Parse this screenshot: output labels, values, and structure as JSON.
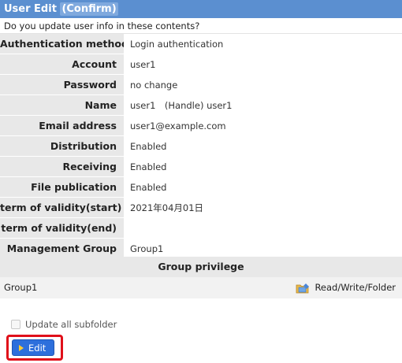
{
  "title": {
    "prefix": "User Edit ",
    "highlight": "(Confirm)"
  },
  "question": "Do you update user info in these contents?",
  "fields": [
    {
      "label": "Authentication method",
      "value": "Login authentication"
    },
    {
      "label": "Account",
      "value": "user1"
    },
    {
      "label": "Password",
      "value": "no change"
    },
    {
      "label": "Name",
      "value": "user1　(Handle) user1"
    },
    {
      "label": "Email address",
      "value": "user1@example.com"
    },
    {
      "label": "Distribution",
      "value": "Enabled"
    },
    {
      "label": "Receiving",
      "value": "Enabled"
    },
    {
      "label": "File publication",
      "value": "Enabled"
    },
    {
      "label": "term of validity(start)",
      "value": "2021年04月01日"
    },
    {
      "label": "term of validity(end)",
      "value": ""
    },
    {
      "label": "Management Group",
      "value": "Group1"
    }
  ],
  "group_privilege": {
    "header": "Group privilege",
    "rows": [
      {
        "group": "Group1",
        "permission": "Read/Write/Folder",
        "icon": "folder-permission-icon"
      }
    ]
  },
  "update_subfolder": {
    "label": "Update all subfolder",
    "checked": false
  },
  "edit_button": {
    "label": "Edit",
    "icon": "play-arrow-icon"
  },
  "colors": {
    "title_bar": "#5b8fd0",
    "label_bg": "#e8e8e8",
    "button_bg": "#2d6fdc",
    "highlight_border": "#e0101a"
  }
}
